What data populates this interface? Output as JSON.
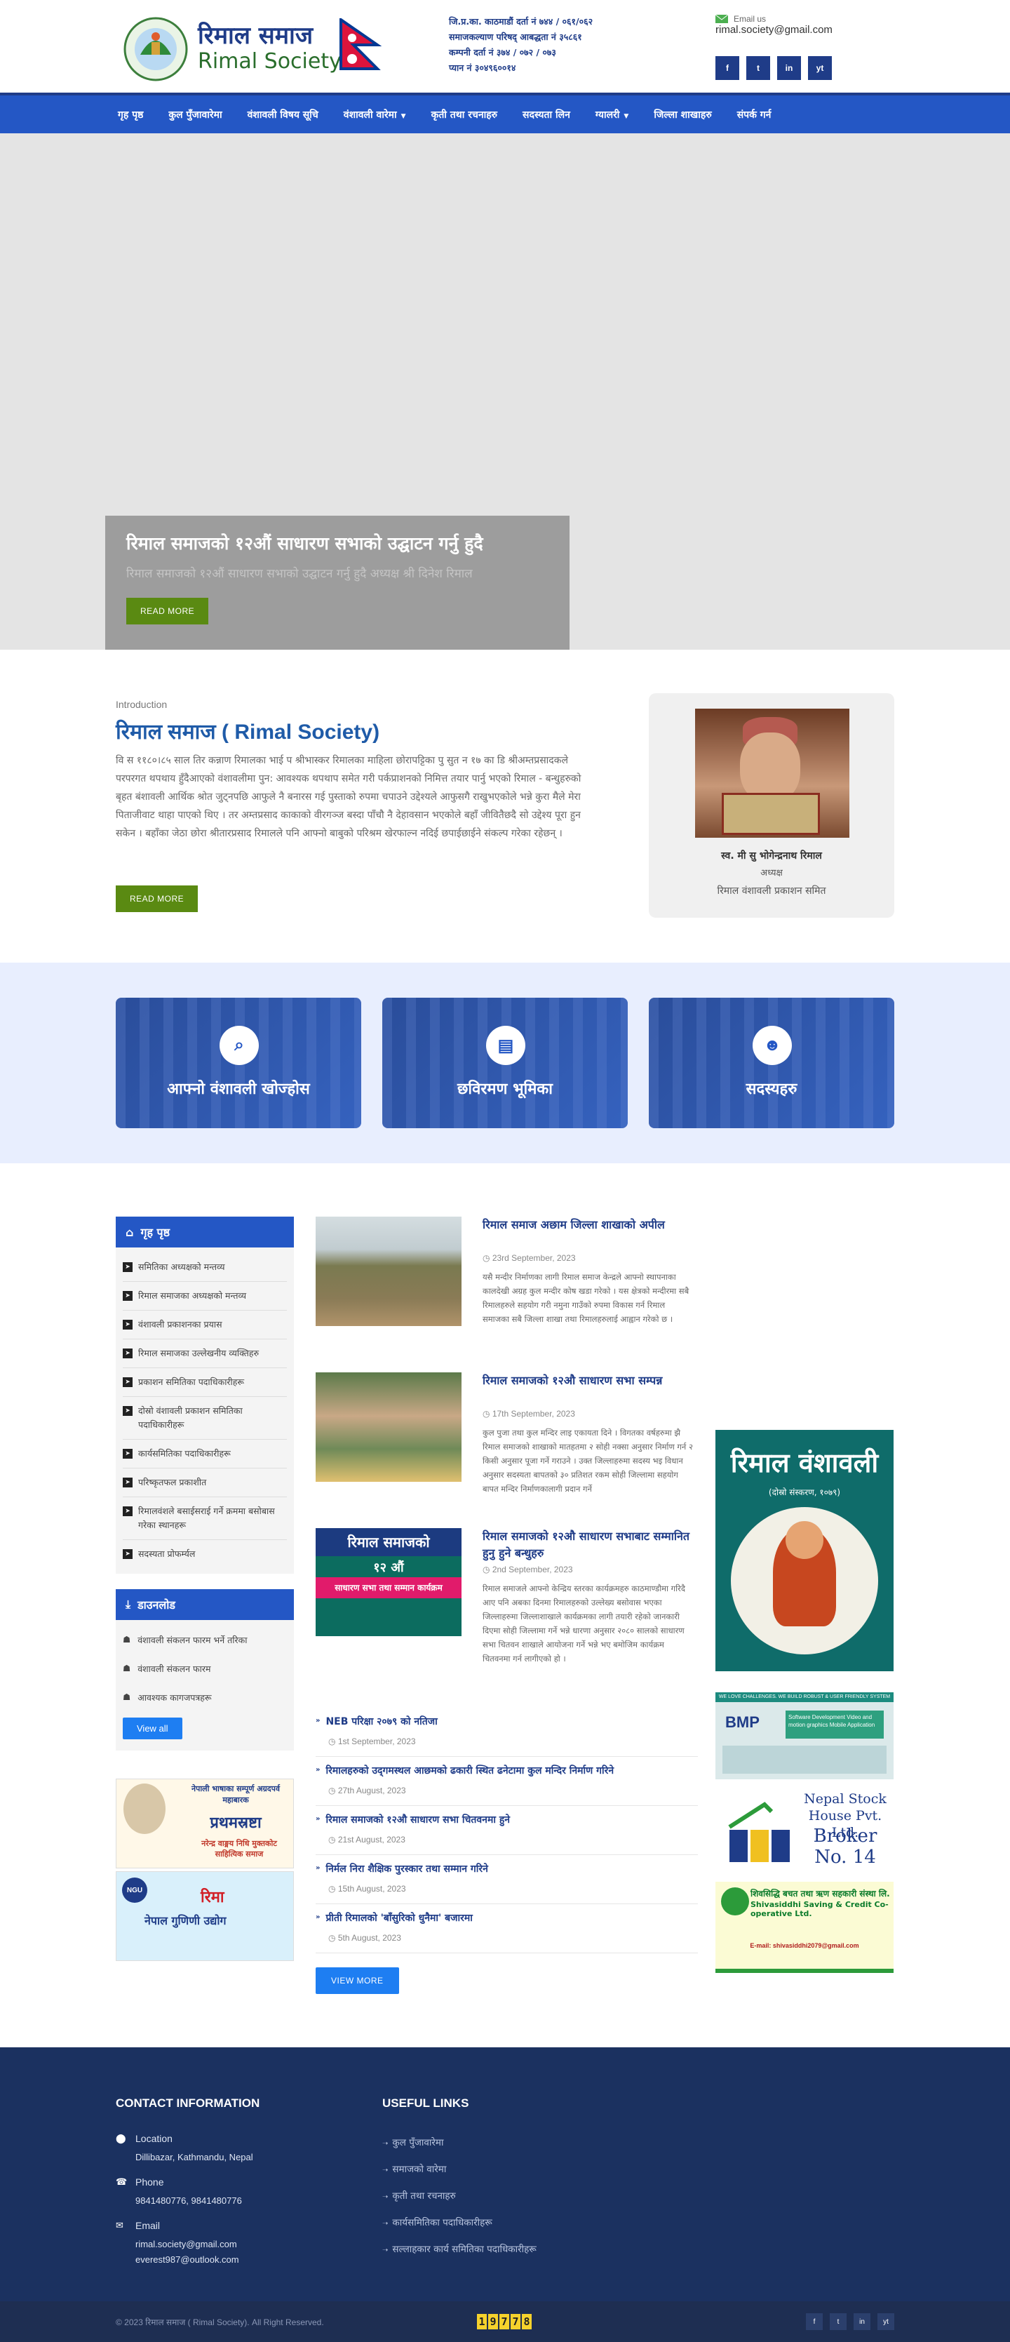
{
  "header": {
    "logo_ne": "रिमाल समाज",
    "logo_en": "Rimal Society",
    "reg_lines": [
      "जि.प्र.का. काठमाडौं दर्ता नं ७४४ / ०६१/०६२",
      "समाजकल्याण परिषद् आबद्धता नं ३५८६१",
      "कम्पनी दर्ता नं ३७४ / ०७२ / ०७३",
      "प्यान नं ३०४९६००१४"
    ],
    "email_label": "Email us",
    "email": "rimal.society@gmail.com",
    "social": [
      "f",
      "t",
      "in",
      "yt"
    ]
  },
  "nav": [
    {
      "label": "गृह पृष्ठ",
      "dropdown": false
    },
    {
      "label": "कुल पुँजावारेमा",
      "dropdown": false
    },
    {
      "label": "वंशावली विषय सूचि",
      "dropdown": false
    },
    {
      "label": "वंशावली वारेमा",
      "dropdown": true
    },
    {
      "label": "कृती तथा रचनाहरु",
      "dropdown": false
    },
    {
      "label": "सदस्यता लिन",
      "dropdown": false
    },
    {
      "label": "ग्यालरी",
      "dropdown": true
    },
    {
      "label": "जिल्ला शाखाहरु",
      "dropdown": false
    },
    {
      "label": "संपर्क गर्न",
      "dropdown": false
    }
  ],
  "hero": {
    "title": "रिमाल समाजको १२औं साधारण सभाको उद्घाटन गर्नु हुदै",
    "subtitle": "रिमाल समाजको १२औं साधारण सभाको उद्घाटन गर्नु हुदै अध्यक्ष श्री दिनेश रिमाल",
    "button": "READ MORE"
  },
  "intro": {
    "label": "Introduction",
    "title": "रिमाल समाज ( Rimal Society)",
    "text": "वि स ११८०।८५ साल तिर कन्नाण रिमालका भाई प श्रीभास्कर रिमालका माहिला छोरापट्टिका पु सुत न १७ का डि श्रीअम्तप्रसादकले परपरगत थपथाय हुँदैआएको वंशावलीमा पुन: आवश्यक थपथाप समेत गरी पर्कप्राशनको निमित्त तयार पार्नु भएको रिमाल - बन्धुहरुको बृहत बंशावली आर्थिक श्रोत जुट्नपछि आफुले नै बनारस गई पुस्ताको रुपमा चपाउने उद्देश्यले आफुसगै राखुभएकोले भन्ने कुरा मैले मेरा पिताजीवाट थाहा पाएको थिए । तर अम्तप्रसाद काकाको वीरगञ्ज बस्दा पाँचौ नै देहावसान भएकोले बहाँ जीवितैछदै सो उद्देश्य पूरा हुन सकेन । बहाँका जेठा छोरा श्रीतारप्रसाद रिमालले पनि आफ्नो बाबुको परिश्रम खेरफाल्न नदिई छपाईछाईने संकल्प गरेका रहेछन् ।",
    "button": "READ MORE",
    "person_name": "स्व. मी सु भोगेन्द्रनाथ रिमाल",
    "person_role": "अध्यक्ष",
    "person_org": "रिमाल वंशावली प्रकाशन समित"
  },
  "features": [
    {
      "icon": "⌕",
      "label": "आफ्नो वंशावली खोज्होस",
      "icon_name": "search-person-icon"
    },
    {
      "icon": "▤",
      "label": "छविरमण भूमिका",
      "icon_name": "book-icon"
    },
    {
      "icon": "☻",
      "label": "सदस्यहरु",
      "icon_name": "members-icon"
    }
  ],
  "sidebar": {
    "home_title": "गृह पृष्ठ",
    "home_items": [
      "समितिका अध्यक्षको मन्तव्य",
      "रिमाल समाजका अध्यक्षको मन्तव्य",
      "वंशावली प्रकाशनका प्रयास",
      "रिमाल समाजका उल्लेखनीय व्यक्तिहरु",
      "प्रकाशन समितिका पदाधिकारीहरू",
      "दोस्रो वंशावली प्रकाशन समितिका पदाधिकारीहरू",
      "कार्यसमितिका पदाधिकारीहरू",
      "परिष्कृतफल प्रकाशीत",
      "रिमालवंशले बसाईसराई गर्ने क्रममा बसोबास गरेका स्थानहरू",
      "सदस्यता प्रोफर्म्यल"
    ],
    "download_title": "डाउनलोड",
    "download_items": [
      "वंशावली संकलन फारम भर्ने तरिका",
      "वंशावली संकलन फारम",
      "आवश्यक कागजपत्रहरू"
    ],
    "view_all": "View all",
    "ad1": {
      "line1": "नेपाली भाषाका सम्पूर्ण अग्रदपर्व महाबारक",
      "line2": "प्रथमस्रष्टा",
      "line3": "नरेन्द्र वाङ्मय निधि मुक्तकोट साहित्यिक समाज"
    },
    "ad2": {
      "logo": "NGU",
      "brand": "रिमा",
      "company": "नेपाल गुणिणी उद्योग"
    }
  },
  "posts": [
    {
      "title": "रिमाल समाज अछाम जिल्ला शाखाको अपील",
      "date": "23rd September, 2023",
      "excerpt": "यसै मन्दीर निर्माणका लागी रिमाल समाज केन्द्रले आफ्नो स्थापनाका कालदेखी अग्रह कुल मन्दीर कोष खडा गरेको । यस क्षेत्रको मन्दीरमा सबै रिमालहरुले सहयोग गरी नमुना गाउँको रुपमा विकास गर्न रिमाल समाजका सबै जिल्ला शाखा तथा रिमालहरुलाई आह्वान गरेको छ ।"
    },
    {
      "title": "रिमाल समाजको १२औ साधारण सभा सम्पन्न",
      "date": "17th September, 2023",
      "excerpt": "कुल पुजा तथा कुल मन्दिर लाइ एकायता दिने । विगतका वर्षहरुमा झै रिमाल समाजको शाखाको मातहतमा २ सोही नक्सा अनुसार निर्माण गर्न २ किसी अनुसार पूजा गर्ने गराउने । उक्त जिल्लाहरुमा सदस्य भइ विधान अनुसार सदस्यता बापतको ३० प्रतिशत रकम सोही जिल्लामा सहयोग बापत मन्दिर निर्माणकालागी प्रदान गर्ने"
    },
    {
      "title": "रिमाल समाजको १२औ साधारण सभाबाट सम्मानित हुनु हुने बन्धुहरु",
      "date": "2nd September, 2023",
      "excerpt": "रिमाल समाजले आफ्नो केन्द्रिय स्तरका कार्यक्रमहरु काठमाण्डौमा गरिदै आए पनि अबका दिनमा रिमालहरुको उल्लेख्य बसोवास भएका जिल्लाहरुमा जिल्लाशाखाले कार्यक्रमका लागी तयारी रहेको जानकारी दिएमा सोही जिल्लामा गर्ने भन्ने धारणा अनुसार २०८० सालको साधारण सभा चितवन शाखाले आयोजना गर्ने भन्ने भए बमोजिम कार्यक्रम चितवनमा गर्न लागीएको हो ।",
      "thumb": {
        "a": "रिमाल समाजको",
        "b": "१२ औं",
        "c": "साधारण सभा तथा सम्मान कार्यक्रम"
      }
    }
  ],
  "post_list": [
    {
      "title": "NEB परिक्षा २०७९ को नतिजा",
      "date": "1st September, 2023"
    },
    {
      "title": "रिमालहरुको उद्‌गमस्थल आछमको ढकारी स्थित ढनेटामा कुल मन्दिर निर्माण गरिने",
      "date": "27th August, 2023"
    },
    {
      "title": "रिमाल समाजको १२औ साधारण सभा चितवनमा हुने",
      "date": "21st August, 2023"
    },
    {
      "title": "निर्मल निरा शैक्षिक पुरस्कार तथा सम्मान गरिने",
      "date": "15th August, 2023"
    },
    {
      "title": "प्रीती रिमालको 'बाँसुरिको धुनैमा' बजारमा",
      "date": "5th August, 2023"
    }
  ],
  "view_more": "VIEW MORE",
  "right_ads": {
    "book_title": "रिमाल वंशावली",
    "book_sub": "(दोस्रो संस्करण, १०७९)",
    "bmp_top": "WE LOVE CHALLENGES. WE BUILD ROBUST & USER FRIENDLY SYSTEM",
    "bmp_name": "BMP",
    "bmp_service": "Software Development Video and motion graphics Mobile Application",
    "nepse_name": "Nepal Stock House Pvt. Ltd.",
    "nepse_broker": "Broker No. 14",
    "coop_ne": "शिवसिद्धि बचत तथा ऋण सहकारी संस्था लि.",
    "coop_en": "Shivasiddhi Saving & Credit Co-operative Ltd.",
    "coop_email": "E-mail: shivasiddhi2079@gmail.com"
  },
  "footer": {
    "contact_title": "CONTACT INFORMATION",
    "links_title": "USEFUL LINKS",
    "location_label": "Location",
    "location": "Dillibazar, Kathmandu, Nepal",
    "phone_label": "Phone",
    "phone": "9841480776, 9841480776",
    "email_label": "Email",
    "email1": "rimal.society@gmail.com",
    "email2": "everest987@outlook.com",
    "links": [
      "कुल पुँजावारेमा",
      "समाजको वारेमा",
      "कृती तथा रचनाहरु",
      "कार्यसमितिका पदाधिकारीहरू",
      "सल्लाहकार कार्य समितिका पदाधिकारीहरू"
    ],
    "copyright": "© 2023 रिमाल समाज ( Rimal Society). All Right Reserved.",
    "counter": [
      "1",
      "9",
      "7",
      "7",
      "8"
    ]
  },
  "colors": {
    "brand_blue": "#2457c5",
    "dark_blue": "#1f3c88",
    "green_button": "#5a8a12",
    "footer_bg": "#1b3160"
  }
}
